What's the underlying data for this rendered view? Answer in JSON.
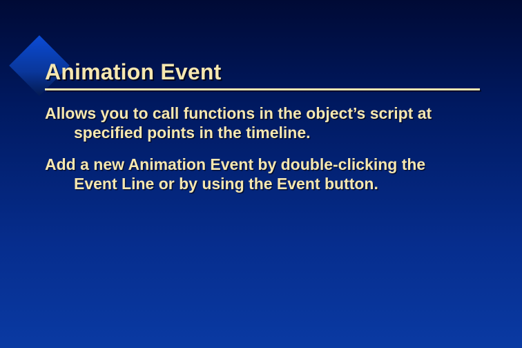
{
  "slide": {
    "title": "Animation Event",
    "paragraphs": [
      "Allows you to call functions in the object’s script at specified points in the timeline.",
      "Add a new Animation Event by double-clicking the Event Line or by using the Event button."
    ]
  }
}
